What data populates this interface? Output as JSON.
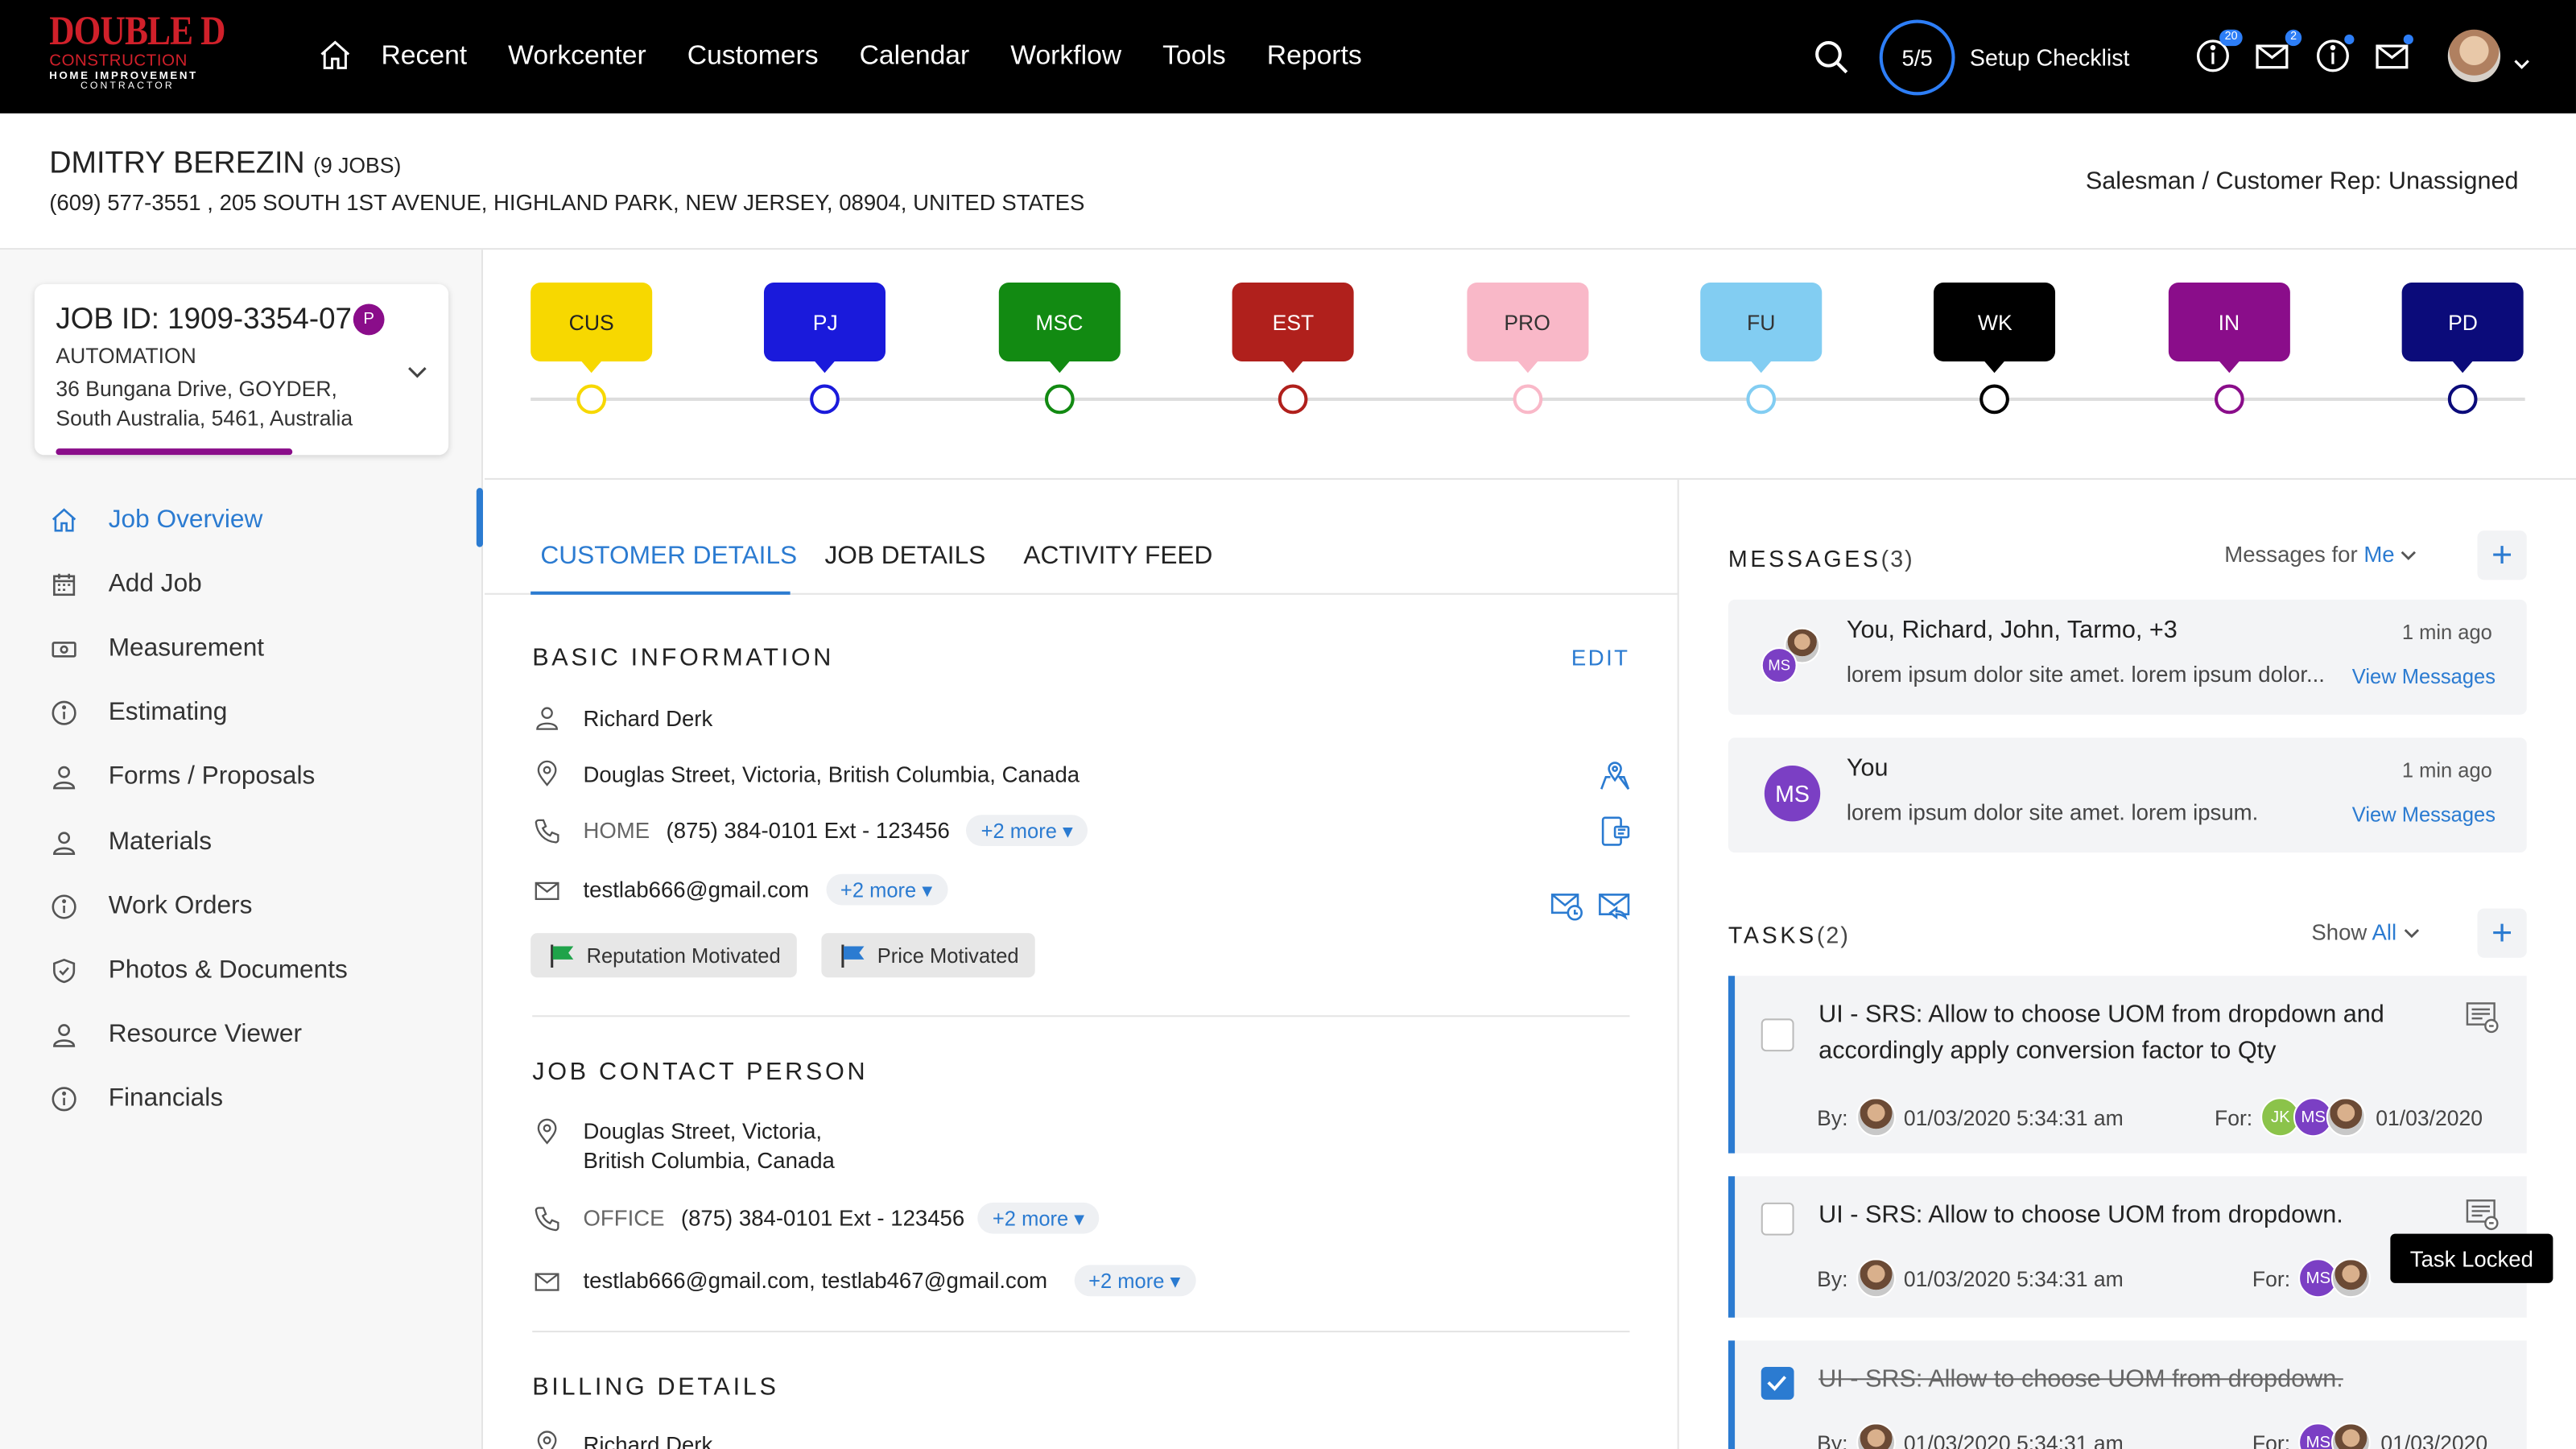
{
  "brand": {
    "line1": "DOUBLE D",
    "line2": "CONSTRUCTION",
    "line3": "HOME IMPROVEMENT",
    "line4": "CONTRACTOR"
  },
  "nav": {
    "items": [
      "Recent",
      "Workcenter",
      "Customers",
      "Calendar",
      "Workflow",
      "Tools",
      "Reports"
    ]
  },
  "topbar": {
    "setup_progress": "5/5",
    "setup_label": "Setup Checklist",
    "badge_notifications": "20",
    "badge_messages": "2"
  },
  "customer": {
    "name": "DMITRY BEREZIN",
    "jobs": "(9 JOBS)",
    "contact": "(609) 577-3551 , 205 SOUTH 1ST AVENUE, HIGHLAND PARK, NEW JERSEY, 08904, UNITED STATES",
    "salesman": "Salesman / Customer Rep: Unassigned"
  },
  "job_card": {
    "job_id": "JOB ID: 1909-3354-07",
    "badge": "P",
    "type": "AUTOMATION",
    "address_line1": "36 Bungana Drive, GOYDER,",
    "address_line2": "South Australia, 5461, Australia",
    "progress_fraction": 0.57
  },
  "sidebar": {
    "items": [
      {
        "label": "Job Overview",
        "icon": "home-icon",
        "active": true
      },
      {
        "label": "Add Job",
        "icon": "calendar-icon"
      },
      {
        "label": "Measurement",
        "icon": "tape-icon"
      },
      {
        "label": "Estimating",
        "icon": "info-icon"
      },
      {
        "label": "Forms / Proposals",
        "icon": "user-icon"
      },
      {
        "label": "Materials",
        "icon": "user-icon"
      },
      {
        "label": "Work Orders",
        "icon": "info-icon"
      },
      {
        "label": "Photos & Documents",
        "icon": "shield-icon"
      },
      {
        "label": "Resource Viewer",
        "icon": "user-icon"
      },
      {
        "label": "Financials",
        "icon": "info-icon"
      }
    ]
  },
  "stages": [
    {
      "label": "CUS",
      "color": "#f7d800",
      "text": "#222"
    },
    {
      "label": "PJ",
      "color": "#1a1adb",
      "text": "#fff"
    },
    {
      "label": "MSC",
      "color": "#128a12",
      "text": "#fff"
    },
    {
      "label": "EST",
      "color": "#b0201c",
      "text": "#fff"
    },
    {
      "label": "PRO",
      "color": "#f9b8c8",
      "text": "#333"
    },
    {
      "label": "FU",
      "color": "#82cdf2",
      "text": "#333"
    },
    {
      "label": "WK",
      "color": "#000000",
      "text": "#fff"
    },
    {
      "label": "IN",
      "color": "#8a0d8a",
      "text": "#fff"
    },
    {
      "label": "PD",
      "color": "#0b0b7a",
      "text": "#fff"
    }
  ],
  "tabs": [
    {
      "label": "CUSTOMER DETAILS",
      "active": true
    },
    {
      "label": "JOB DETAILS"
    },
    {
      "label": "ACTIVITY FEED"
    }
  ],
  "basic_info": {
    "title": "BASIC INFORMATION",
    "edit": "EDIT",
    "name": "Richard Derk",
    "address": "Douglas Street, Victoria, British Columbia, Canada",
    "phone_type": "HOME",
    "phone": "(875) 384-0101 Ext - 123456",
    "phone_more": "+2 more",
    "email": "testlab666@gmail.com",
    "email_more": "+2 more",
    "tags": [
      "Reputation Motivated",
      "Price  Motivated"
    ]
  },
  "job_contact": {
    "title": "JOB CONTACT PERSON",
    "address_line1": "Douglas Street, Victoria,",
    "address_line2": "British Columbia, Canada",
    "phone_type": "OFFICE",
    "phone": "(875) 384-0101 Ext - 123456",
    "phone_more": "+2 more",
    "email": "testlab666@gmail.com, testlab467@gmail.com",
    "email_more": "+2 more"
  },
  "billing": {
    "title": "BILLING DETAILS",
    "name": "Richard Derk"
  },
  "messages": {
    "title": "MESSAGES",
    "count": "(3)",
    "filter_label": "Messages for",
    "filter_value": "Me",
    "items": [
      {
        "who": "You, Richard, John, Tarmo, +3",
        "time": "1 min ago",
        "body": "lorem ipsum dolor site amet. lorem ipsum dolor...",
        "view": "View Messages",
        "initials": "MS"
      },
      {
        "who": "You",
        "time": "1 min ago",
        "body": "lorem ipsum dolor site amet. lorem ipsum.",
        "view": "View Messages",
        "initials": "MS"
      }
    ]
  },
  "tasks": {
    "title": "TASKS",
    "count": "(2)",
    "filter_label": "Show",
    "filter_value": "All",
    "by_label": "By:",
    "for_label": "For:",
    "items": [
      {
        "title_line1": "UI - SRS: Allow to choose UOM from dropdown and",
        "title_line2": "accordingly apply conversion factor to Qty",
        "by_date": "01/03/2020 5:34:31 am",
        "for_date": "01/03/2020",
        "done": false
      },
      {
        "title_line1": "UI - SRS: Allow to choose UOM from dropdown.",
        "by_date": "01/03/2020 5:34:31 am",
        "done": false
      },
      {
        "title_line1": "UI - SRS: Allow to choose UOM from dropdown.",
        "by_date": "01/03/2020 5:34:31 am",
        "for_date": "01/03/2020",
        "done": true
      }
    ],
    "assignee_initials": [
      "JK",
      "MS"
    ],
    "tooltip": "Task Locked"
  },
  "colors": {
    "accent": "#2b7bd1",
    "purple": "#8a0d8a",
    "green_avatar": "#8bc34a",
    "ms_avatar": "#7b3fc4"
  }
}
